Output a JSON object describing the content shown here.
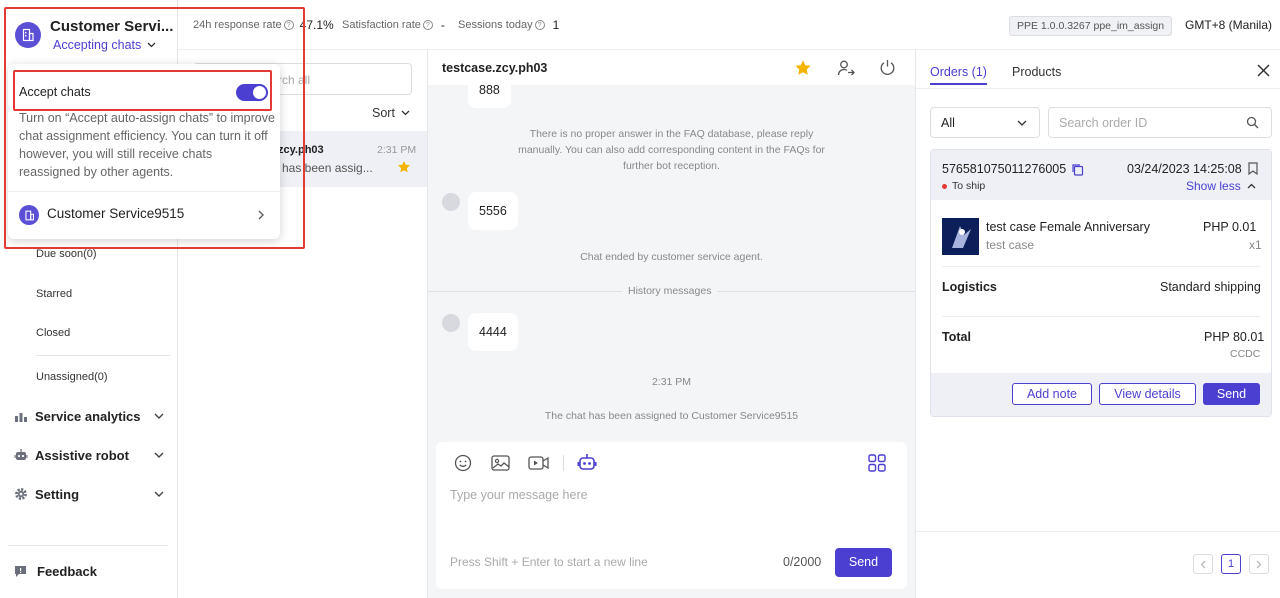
{
  "account": {
    "name": "Customer Servi...",
    "status": "Accepting chats"
  },
  "header": {
    "metrics": [
      {
        "label": "24h response rate",
        "value": "47.1%"
      },
      {
        "label": "Satisfaction rate",
        "value": "-"
      },
      {
        "label": "Sessions today",
        "value": "1"
      }
    ],
    "version": "PPE 1.0.0.3267 ppe_im_assign",
    "timezone": "GMT+8 (Manila)"
  },
  "popover": {
    "toggle_label": "Accept chats",
    "toggle_on": true,
    "description": "Turn on “Accept auto-assign chats” to improve chat assignment efficiency. You can turn it off however, you will still receive chats reassigned by other agents.",
    "agent_name": "Customer Service9515"
  },
  "sidebar": {
    "subitems": [
      "Due soon(0)",
      "Starred",
      "Closed",
      "Unassigned(0)"
    ],
    "groups": [
      {
        "label": "Service analytics",
        "icon": "bar-chart-icon"
      },
      {
        "label": "Assistive robot",
        "icon": "robot-icon"
      },
      {
        "label": "Setting",
        "icon": "gear-icon"
      }
    ],
    "feedback": "Feedback"
  },
  "chatlist": {
    "search_placeholder": "rch all",
    "sort_label": "Sort",
    "item": {
      "name": "zcy.ph03",
      "time": "2:31 PM",
      "preview": "has been assig..."
    }
  },
  "conversation": {
    "title": "testcase.zcy.ph03",
    "messages": {
      "partial": "888",
      "faq_notice": "There is no proper answer in the FAQ database, please reply manually. You can also add corresponding content in the FAQs for further bot reception.",
      "msg1": "5556",
      "chat_ended": "Chat ended by customer service agent.",
      "history": "History messages",
      "msg2": "4444",
      "time": "2:31 PM",
      "assigned": "The chat has been assigned to Customer Service9515"
    },
    "composer": {
      "placeholder": "Type your message here",
      "hint": "Press Shift + Enter to start a new line",
      "counter": "0/2000",
      "send": "Send"
    }
  },
  "rightpanel": {
    "tabs": [
      "Orders (1)",
      "Products"
    ],
    "filter": "All",
    "search_placeholder": "Search order ID",
    "order": {
      "id": "576581075011276005",
      "datetime": "03/24/2023 14:25:08",
      "status": "To ship",
      "toggle": "Show less",
      "product_name": "test case Female Anniversary",
      "product_variant": "test case",
      "product_price": "PHP 0.01",
      "product_qty": "x1",
      "logistics_label": "Logistics",
      "logistics_value": "Standard shipping",
      "total_label": "Total",
      "total_value": "PHP 80.01",
      "total_note": "CCDC",
      "buttons": [
        "Add note",
        "View details",
        "Send"
      ]
    },
    "pagination": {
      "page": "1"
    }
  },
  "colors": {
    "accent": "#4a3fd1",
    "highlight": "#e53935",
    "star": "#f5b400"
  }
}
